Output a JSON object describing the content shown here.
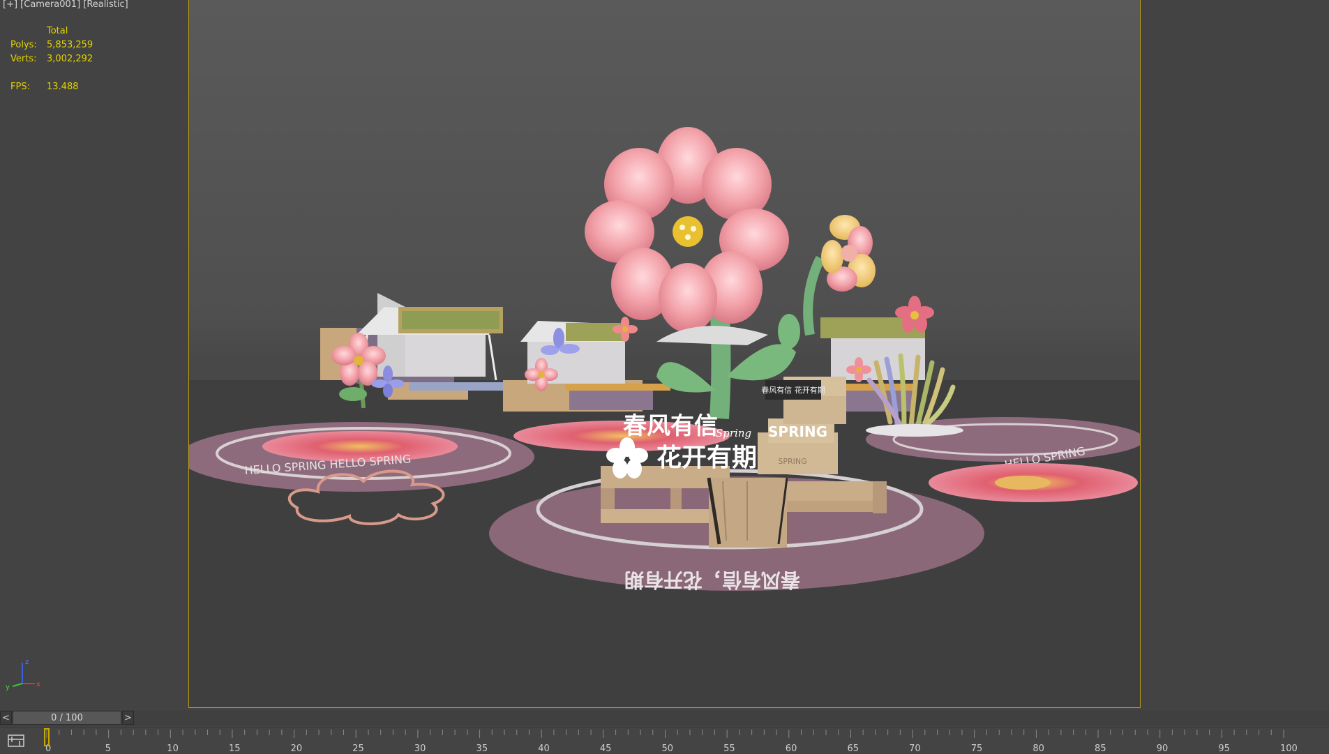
{
  "viewport": {
    "label": "[+] [Camera001] [Realistic]",
    "stats": {
      "header": "Total",
      "polys_label": "Polys:",
      "polys_value": "5,853,259",
      "verts_label": "Verts:",
      "verts_value": "3,002,292",
      "fps_label": "FPS:",
      "fps_value": "13.488"
    },
    "scene": {
      "sign_line1": "春风有信",
      "sign_spring": "Spring",
      "sign_line2": "花开有期",
      "sign_spring_caps": "SPRING",
      "small_crate_text": "SPRING",
      "box_label": "春风有信 花开有期",
      "floor_text_center": "春风有信，花开有期",
      "floor_text_left": "HELLO SPRING HELLO SPRING",
      "floor_text_right": "HELLO SPRING"
    },
    "axis": {
      "x": "x",
      "y": "y",
      "z": "z"
    }
  },
  "timeline": {
    "prev_label": "<",
    "next_label": ">",
    "frame_counter": "0 / 100",
    "current_frame": 0,
    "total_frames": 100,
    "ticks": [
      "0",
      "5",
      "10",
      "15",
      "20",
      "25",
      "30",
      "35",
      "40",
      "45",
      "50",
      "55",
      "60",
      "65",
      "70",
      "75",
      "80",
      "85",
      "90",
      "95",
      "100"
    ]
  },
  "colors": {
    "stats_text": "#e4d300",
    "frame_border": "#b99b14",
    "time_marker": "#c8a800"
  }
}
